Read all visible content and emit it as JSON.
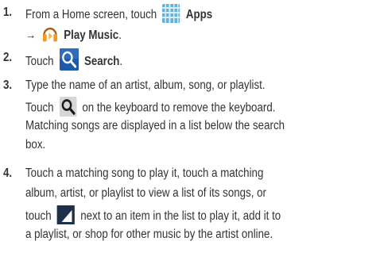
{
  "steps": [
    {
      "number": "1.",
      "line1_pre": "From a Home screen, touch",
      "line1_bold": "Apps",
      "line2_arrow": "→",
      "line2_bold": "Play Music",
      "line2_post": "."
    },
    {
      "number": "2.",
      "pre": "Touch",
      "bold": "Search",
      "post": "."
    },
    {
      "number": "3.",
      "line1": "Type the name of an artist, album, song, or playlist.",
      "line2_pre": "Touch",
      "line2_post": "on the keyboard to remove the keyboard.",
      "line3": "Matching songs are displayed in a list below the search",
      "line4": "box."
    },
    {
      "number": "4.",
      "line1": "Touch a matching song to play it, touch a matching",
      "line2": "album, artist, or playlist to view a list of its songs, or",
      "line3_pre": "touch",
      "line3_post": "next to an item in the list to play it, add it to",
      "line4": "a playlist, or shop for other music by the artist online."
    }
  ],
  "icons": {
    "apps": "apps-grid-icon",
    "play_music": "headphones-icon",
    "search": "search-icon",
    "keyboard_search": "keyboard-search-icon",
    "item_menu": "item-menu-icon"
  },
  "colors": {
    "text": "#333333",
    "apps_blue": "#5aaedb",
    "headphone_orange": "#f29a1f",
    "search_bg": "#1f5aa8"
  }
}
